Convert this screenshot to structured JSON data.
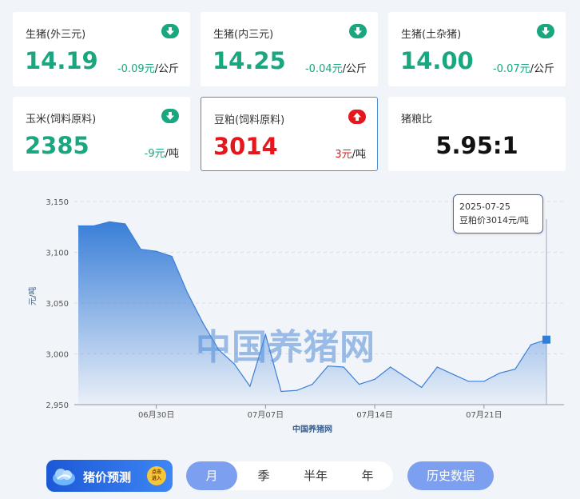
{
  "cards": [
    {
      "title": "生猪(外三元)",
      "price": "14.19",
      "change": "-0.09元",
      "unit": "/公斤",
      "direction": "down"
    },
    {
      "title": "生猪(内三元)",
      "price": "14.25",
      "change": "-0.04元",
      "unit": "/公斤",
      "direction": "down"
    },
    {
      "title": "生猪(土杂猪)",
      "price": "14.00",
      "change": "-0.07元",
      "unit": "/公斤",
      "direction": "down"
    },
    {
      "title": "玉米(饲料原料)",
      "price": "2385",
      "change": "-9元",
      "unit": "/吨",
      "direction": "down"
    },
    {
      "title": "豆粕(饲料原料)",
      "price": "3014",
      "change": "3元",
      "unit": "/吨",
      "direction": "up"
    }
  ],
  "ratio": {
    "title": "猪粮比",
    "value": "5.95:1"
  },
  "colors": {
    "down": "#1aa77f",
    "up": "#e6161d",
    "accent": "#7c9ff0",
    "line": "#3a7fd8"
  },
  "icons": {
    "down": "arrow-down-icon",
    "up": "arrow-up-icon"
  },
  "chart_data": {
    "type": "area",
    "ylabel": "元/吨",
    "xlabel": "中国养猪网",
    "ylim": [
      2950,
      3150
    ],
    "yticks": [
      "3,150",
      "3,100",
      "3,050",
      "3,000",
      "2,950"
    ],
    "ytick_values": [
      3150,
      3100,
      3050,
      3000,
      2950
    ],
    "xticks": [
      {
        "label": "06月30日",
        "date": "2025-06-30"
      },
      {
        "label": "07月07日",
        "date": "2025-07-07"
      },
      {
        "label": "07月14日",
        "date": "2025-07-14"
      },
      {
        "label": "07月21日",
        "date": "2025-07-21"
      }
    ],
    "grid": true,
    "series": [
      {
        "x": [
          "2025-06-25",
          "2025-06-26",
          "2025-06-27",
          "2025-06-28",
          "2025-06-29",
          "2025-06-30",
          "2025-07-01",
          "2025-07-02",
          "2025-07-03",
          "2025-07-04",
          "2025-07-05",
          "2025-07-06",
          "2025-07-07",
          "2025-07-08",
          "2025-07-09",
          "2025-07-10",
          "2025-07-11",
          "2025-07-12",
          "2025-07-13",
          "2025-07-14",
          "2025-07-15",
          "2025-07-16",
          "2025-07-17",
          "2025-07-18",
          "2025-07-19",
          "2025-07-20",
          "2025-07-21",
          "2025-07-22",
          "2025-07-23",
          "2025-07-24",
          "2025-07-25"
        ],
        "values": [
          3126,
          3126,
          3130,
          3128,
          3103,
          3101,
          3096,
          3060,
          3030,
          3004,
          2990,
          2968,
          3019,
          2963,
          2964,
          2970,
          2988,
          2987,
          2970,
          2975,
          2987,
          2977,
          2967,
          2987,
          2980,
          2973,
          2973,
          2981,
          2985,
          3009,
          3014
        ]
      }
    ],
    "tooltip": {
      "date": "2025-07-25",
      "text": "豆粕价3014元/吨"
    }
  },
  "watermark": "中国养猪网",
  "forecast": {
    "label": "猪价预测",
    "badge_line1": "点击",
    "badge_line2": "进入"
  },
  "periods": [
    "月",
    "季",
    "半年",
    "年"
  ],
  "active_period": "月",
  "history_label": "历史数据"
}
